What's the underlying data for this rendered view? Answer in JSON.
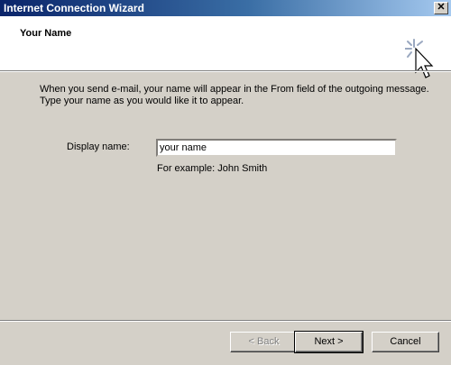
{
  "window": {
    "title": "Internet Connection Wizard",
    "close_glyph": "✕"
  },
  "header": {
    "title": "Your Name",
    "icon": "wizard-cursor-icon"
  },
  "body": {
    "instructions": "When you send e-mail, your name will appear in the From field of the outgoing message. Type your name as you would like it to appear.",
    "display_name_label": "Display name:",
    "display_name_value": "your name",
    "example": "For example: John Smith"
  },
  "buttons": {
    "back": "< Back",
    "next": "Next >",
    "cancel": "Cancel"
  }
}
